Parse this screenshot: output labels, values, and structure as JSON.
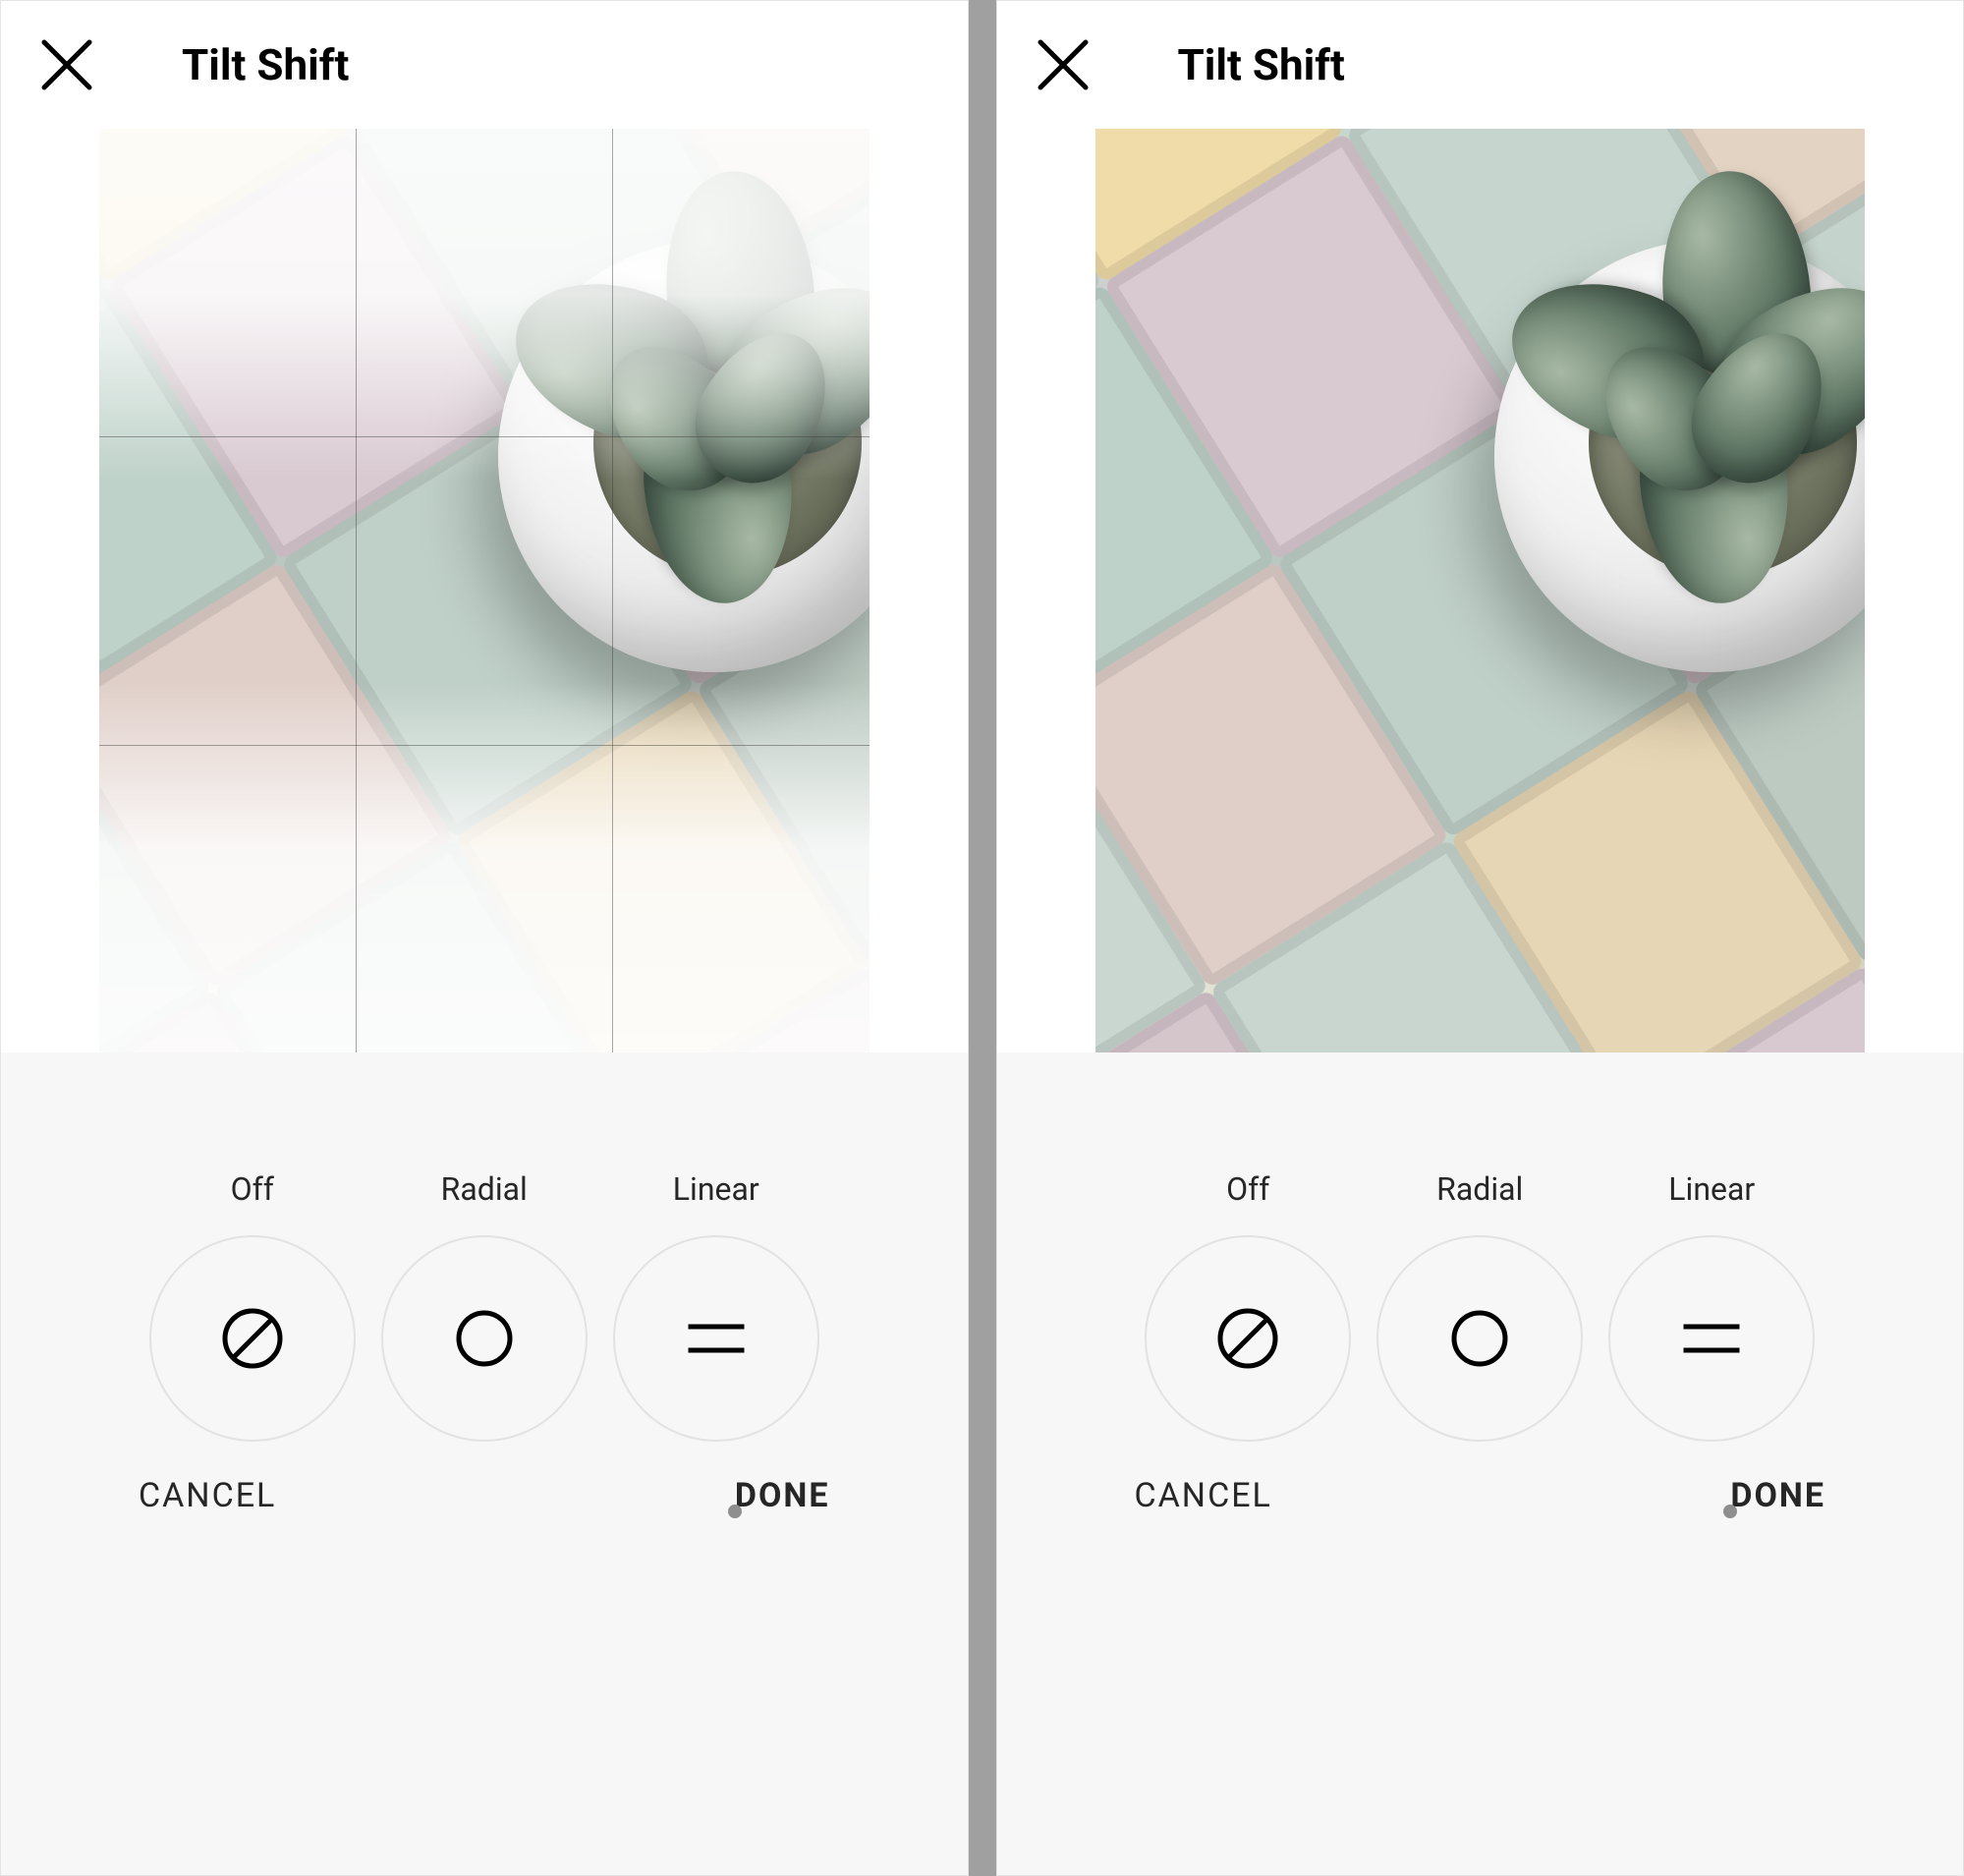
{
  "screens": [
    {
      "header": {
        "title": "Tilt Shift"
      },
      "overlay": {
        "show_haze": true,
        "show_grid": true
      },
      "modes": [
        {
          "label": "Off",
          "icon": "off-icon"
        },
        {
          "label": "Radial",
          "icon": "radial-icon"
        },
        {
          "label": "Linear",
          "icon": "linear-icon"
        }
      ],
      "footer": {
        "cancel": "CANCEL",
        "done": "DONE"
      }
    },
    {
      "header": {
        "title": "Tilt Shift"
      },
      "overlay": {
        "show_haze": false,
        "show_grid": false
      },
      "modes": [
        {
          "label": "Off",
          "icon": "off-icon"
        },
        {
          "label": "Radial",
          "icon": "radial-icon"
        },
        {
          "label": "Linear",
          "icon": "linear-icon"
        }
      ],
      "footer": {
        "cancel": "CANCEL",
        "done": "DONE"
      }
    }
  ],
  "tile_colors": [
    [
      "#d9c7cd",
      "#c7d7cf",
      "#efdca8",
      "#bccac3",
      "#d6c6ca"
    ],
    [
      "#efe7d7",
      "#bfd2ca",
      "#d9c9d1",
      "#c6d6ce",
      "#e3d3c3"
    ],
    [
      "#c9d7d0",
      "#e0cfc9",
      "#bfd0c8",
      "#d8cad0",
      "#c4d3cb"
    ],
    [
      "#d5c6cc",
      "#c8d6cf",
      "#e7d6b5",
      "#bccac2",
      "#d7c7cb"
    ],
    [
      "#ece5d6",
      "#bed1c9",
      "#d8c8d0",
      "#c4d6cd",
      "#e1d1c1"
    ]
  ]
}
